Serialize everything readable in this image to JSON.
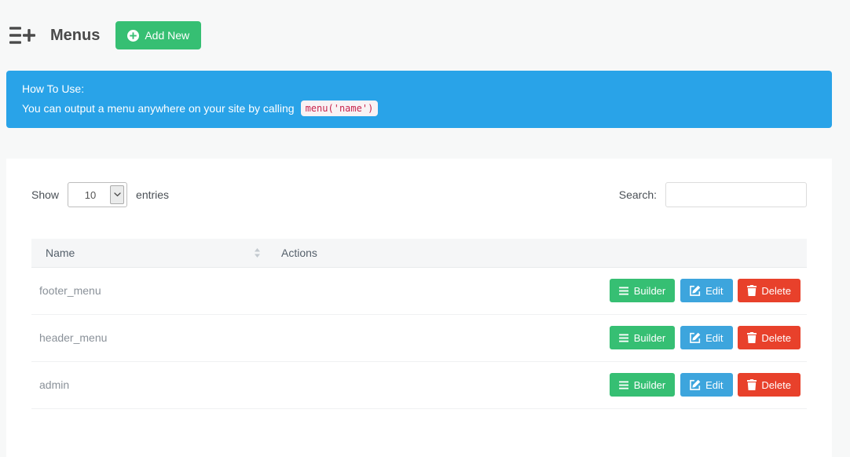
{
  "header": {
    "title": "Menus",
    "add_new_label": "Add New"
  },
  "alert": {
    "heading": "How To Use:",
    "body_text": "You can output a menu anywhere on your site by calling",
    "code_snippet": "menu('name')"
  },
  "controls": {
    "show_label": "Show",
    "entries_label": "entries",
    "page_length_value": "10",
    "page_length_options": [
      "10"
    ],
    "search_label": "Search:",
    "search_value": "",
    "search_placeholder": ""
  },
  "table": {
    "columns": [
      {
        "label": "Name",
        "sortable": true
      },
      {
        "label": "Actions",
        "sortable": false
      }
    ],
    "rows": [
      {
        "name": "footer_menu"
      },
      {
        "name": "header_menu"
      },
      {
        "name": "admin"
      }
    ],
    "action_labels": {
      "builder": "Builder",
      "edit": "Edit",
      "delete": "Delete"
    }
  },
  "icons": {
    "title_icon": "list-add-icon",
    "add_new_icon": "plus-circle-icon",
    "page_length_arrow": "chevron-down-icon",
    "name_column": "sort-arrows-icon",
    "builder_button": "list-icon",
    "edit_button": "edit-pencil-icon",
    "delete_button": "trash-icon"
  },
  "colors": {
    "accent_blue": "#29a3e8",
    "success_green": "#36bf73",
    "info_blue": "#3da5dd",
    "danger_red": "#e8412b",
    "code_text": "#c7254e",
    "code_bg": "#f9f2f4",
    "page_bg": "#f7f8f8",
    "title_text": "#4a4a4a",
    "label_text": "#4a5056",
    "th_text": "#55606b",
    "th_bg": "#f5f6f7",
    "row_text": "#8a9199"
  }
}
